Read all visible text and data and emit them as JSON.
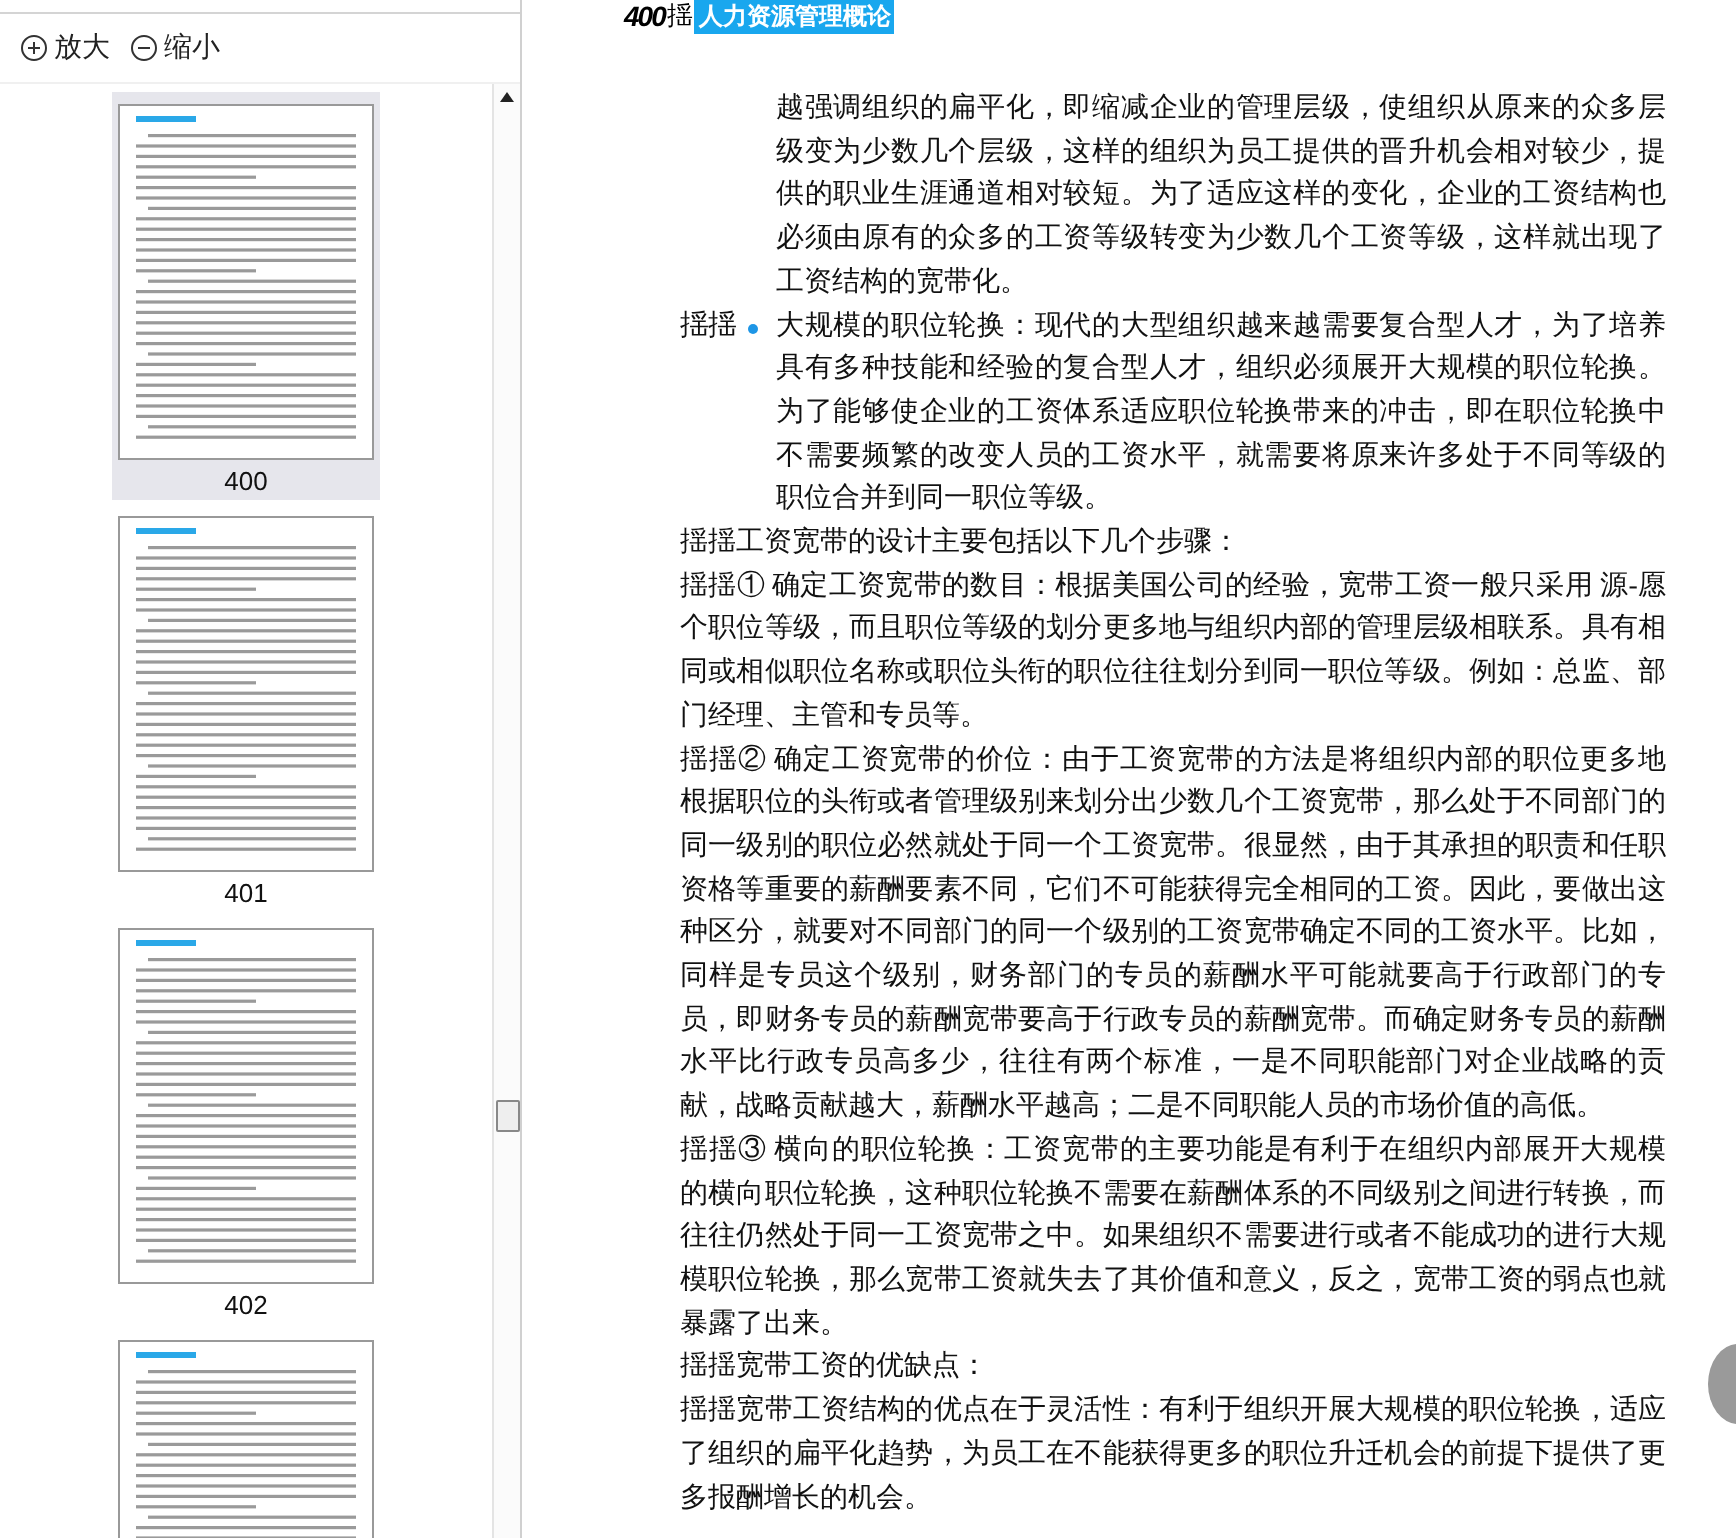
{
  "sidebar": {
    "toolbar": [
      {
        "kind": "zoom-in",
        "label": "放大"
      },
      {
        "kind": "zoom-out",
        "label": "缩小"
      }
    ],
    "thumbnails": [
      {
        "page_label": "400",
        "selected": true
      },
      {
        "page_label": "401",
        "selected": false
      },
      {
        "page_label": "402",
        "selected": false
      },
      {
        "selected": false
      }
    ]
  },
  "page": {
    "header": {
      "page_number": "400",
      "marker": "揺",
      "title": "人力资源管理概论"
    },
    "paragraphs": [
      {
        "kind": "indented",
        "text": "越强调组织的扁平化，即缩减企业的管理层级，使组织从原来的众多层级变为少数几个层级，这样的组织为员工提供的晋升机会相对较少，提供的职业生涯通道相对较短。为了适应这样的变化，企业的工资结构也必须由原有的众多的工资等级转变为少数几个工资等级，这样就出现了工资结构的宽带化。"
      },
      {
        "kind": "bullet",
        "prefix": "揺揺",
        "text": "大规模的职位轮换：现代的大型组织越来越需要复合型人才，为了培养具有多种技能和经验的复合型人才，组织必须展开大规模的职位轮换。为了能够使企业的工资体系适应职位轮换带来的冲击，即在职位轮换中不需要频繁的改变人员的工资水平，就需要将原来许多处于不同等级的职位合并到同一职位等级。"
      },
      {
        "kind": "plain",
        "text": "揺揺工资宽带的设计主要包括以下几个步骤："
      },
      {
        "kind": "plain",
        "text": "揺揺① 确定工资宽带的数目：根据美国公司的经验，宽带工资一般只采用 源-愿个职位等级，而且职位等级的划分更多地与组织内部的管理层级相联系。具有相同或相似职位名称或职位头衔的职位往往划分到同一职位等级。例如：总监、部门经理、主管和专员等。"
      },
      {
        "kind": "plain",
        "text": "揺揺② 确定工资宽带的价位：由于工资宽带的方法是将组织内部的职位更多地根据职位的头衔或者管理级别来划分出少数几个工资宽带，那么处于不同部门的同一级别的职位必然就处于同一个工资宽带。很显然，由于其承担的职责和任职资格等重要的薪酬要素不同，它们不可能获得完全相同的工资。因此，要做出这种区分，就要对不同部门的同一个级别的工资宽带确定不同的工资水平。比如，同样是专员这个级别，财务部门的专员的薪酬水平可能就要高于行政部门的专员，即财务专员的薪酬宽带要高于行政专员的薪酬宽带。而确定财务专员的薪酬水平比行政专员高多少，往往有两个标准，一是不同职能部门对企业战略的贡献，战略贡献越大，薪酬水平越高；二是不同职能人员的市场价值的高低。"
      },
      {
        "kind": "plain",
        "text": "揺揺③ 横向的职位轮换：工资宽带的主要功能是有利于在组织内部展开大规模的横向职位轮换，这种职位轮换不需要在薪酬体系的不同级别之间进行转换，而往往仍然处于同一工资宽带之中。如果组织不需要进行或者不能成功的进行大规模职位轮换，那么宽带工资就失去了其价值和意义，反之，宽带工资的弱点也就暴露了出来。"
      },
      {
        "kind": "plain",
        "text": "揺揺宽带工资的优缺点："
      },
      {
        "kind": "plain",
        "text": "揺揺宽带工资结构的优点在于灵活性：有利于组织开展大规模的职位轮换，适应了组织的扁平化趋势，为员工在不能获得更多的职位升迁机会的前提下提供了更多报酬增长的机会。"
      }
    ]
  }
}
